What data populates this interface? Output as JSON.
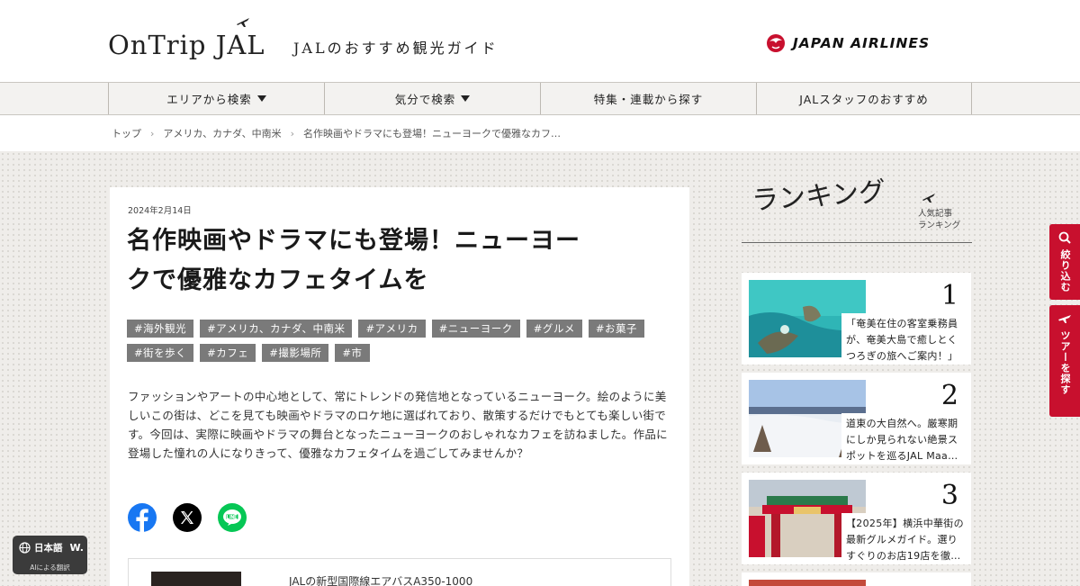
{
  "header": {
    "logo_text": "OnTrip JAL",
    "tagline": "JALのおすすめ観光ガイド",
    "airline_name": "JAPAN AIRLINES"
  },
  "nav": {
    "items": [
      {
        "label": "エリアから検索",
        "dropdown": true
      },
      {
        "label": "気分で検索",
        "dropdown": true
      },
      {
        "label": "特集・連載から探す",
        "dropdown": false
      },
      {
        "label": "JALスタッフのおすすめ",
        "dropdown": false
      }
    ]
  },
  "breadcrumb": {
    "items": [
      "トップ",
      "アメリカ、カナダ、中南米",
      "名作映画やドラマにも登場！ニューヨークで優雅なカフ…"
    ]
  },
  "article": {
    "date": "2024年2月14日",
    "title_line1": "名作映画やドラマにも登場！ニューヨー",
    "title_line2": "クで優雅なカフェタイムを",
    "tags_row1": [
      "#海外観光",
      "#アメリカ、カナダ、中南米",
      "#アメリカ",
      "#ニューヨーク",
      "#グルメ",
      "#お菓子"
    ],
    "tags_row2": [
      "#街を歩く",
      "#カフェ",
      "#撮影場所",
      "#市"
    ],
    "lead": "ファッションやアートの中心地として、常にトレンドの発信地となっているニューヨーク。絵のように美しいこの街は、どこを見ても映画やドラマのロケ地に選ばれており、散策するだけでもとても楽しい街です。今回は、実際に映画やドラマの舞台となったニューヨークのおしゃれなカフェを訪ねました。作品に登場した憧れの人になりきって、優雅なカフェタイムを過ごしてみませんか？",
    "related_title": "JALの新型国際線エアバスA350-1000"
  },
  "ranking": {
    "title": "ランキング",
    "subtitle_line1": "人気記事",
    "subtitle_line2": "ランキング",
    "items": [
      {
        "rank": "1",
        "text": "「奄美在住の客室乗務員が、奄美大島で癒しとくつろぎの旅へご案内！」"
      },
      {
        "rank": "2",
        "text": "道東の大自然へ。厳寒期にしか見られない絶景スポットを巡るJAL Maa…"
      },
      {
        "rank": "3",
        "text": "【2025年】横浜中華街の最新グルメガイド。選りすぐりのお店19店を徹…"
      }
    ]
  },
  "side_tabs": {
    "filter_label": "絞り込む",
    "tour_label": "ツアーを探す"
  },
  "translate": {
    "language": "日本語",
    "badge": "W.",
    "caption": "AIによる翻訳"
  },
  "colors": {
    "jal_red": "#c8102e",
    "tag_gray": "#7a7a7a",
    "facebook": "#1877f2",
    "line": "#06c755"
  }
}
